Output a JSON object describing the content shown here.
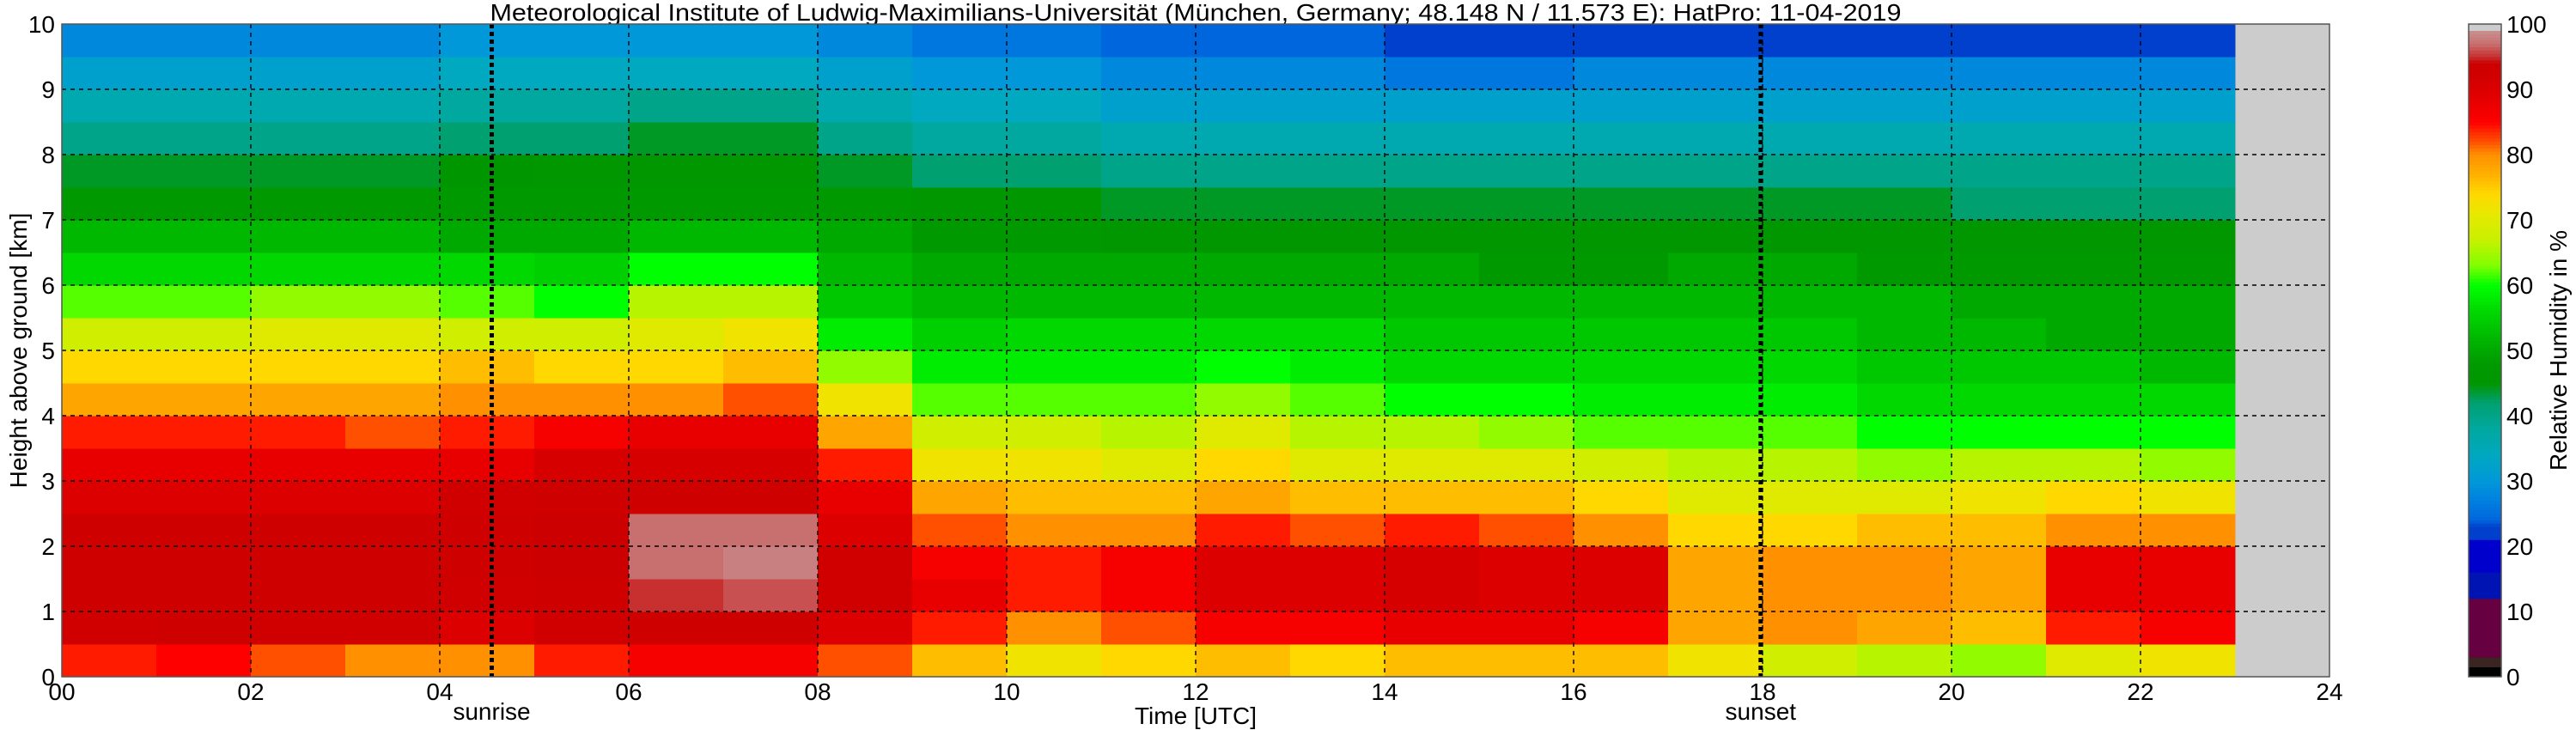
{
  "chart_data": {
    "type": "heatmap",
    "title": "Meteorological Institute of Ludwig-Maximilians-Universität (München, Germany; 48.148 N / 11.573 E):    HatPro: 11-04-2019",
    "xlabel": "Time [UTC]",
    "ylabel": "Height above ground [km]",
    "colorbar_label": "Relative Humidity in %",
    "xlim": [
      0,
      24
    ],
    "ylim": [
      0,
      10
    ],
    "clim": [
      0,
      100
    ],
    "grid": true,
    "x_ticks": [
      "00",
      "02",
      "04",
      "06",
      "08",
      "10",
      "12",
      "14",
      "16",
      "18",
      "20",
      "22",
      "24"
    ],
    "x_tick_values": [
      0,
      2,
      4,
      6,
      8,
      10,
      12,
      14,
      16,
      18,
      20,
      22,
      24
    ],
    "y_ticks": [
      "0",
      "1",
      "2",
      "3",
      "4",
      "5",
      "6",
      "7",
      "8",
      "9",
      "10"
    ],
    "colorbar_ticks": [
      "0",
      "10",
      "20",
      "30",
      "40",
      "50",
      "60",
      "70",
      "80",
      "90",
      "100"
    ],
    "annotations": [
      {
        "label": "sunrise",
        "time": 4.55
      },
      {
        "label": "sunset",
        "time": 17.98
      }
    ],
    "no_data_color": "#cccccc",
    "time_bin_hours": 1,
    "height_bin_km": 0.5,
    "time_start": [
      0,
      1,
      2,
      3,
      4,
      5,
      6,
      7,
      8,
      9,
      10,
      11,
      12,
      13,
      14,
      15,
      16,
      17,
      18,
      19,
      20,
      21,
      22
    ],
    "height_start_km": [
      0,
      0.5,
      1,
      1.5,
      2,
      2.5,
      3,
      3.5,
      4,
      4.5,
      5,
      5.5,
      6,
      6.5,
      7,
      7.5,
      8,
      8.5,
      9,
      9.5
    ],
    "values": [
      [
        84,
        92,
        93,
        93,
        93,
        90,
        88,
        84,
        78,
        74,
        68,
        62,
        56,
        52,
        47,
        44,
        40,
        36,
        32,
        28
      ],
      [
        85,
        93,
        93,
        93,
        93,
        90,
        88,
        84,
        78,
        74,
        68,
        62,
        56,
        52,
        47,
        44,
        40,
        36,
        32,
        28
      ],
      [
        82,
        92,
        93,
        93,
        93,
        90,
        88,
        84,
        78,
        74,
        70,
        64,
        56,
        52,
        48,
        44,
        40,
        36,
        32,
        28
      ],
      [
        80,
        92,
        93,
        93,
        93,
        90,
        88,
        82,
        78,
        74,
        70,
        64,
        56,
        52,
        48,
        44,
        40,
        36,
        32,
        28
      ],
      [
        80,
        90,
        92,
        93,
        93,
        92,
        88,
        84,
        80,
        76,
        68,
        62,
        56,
        50,
        48,
        45,
        42,
        38,
        34,
        30
      ],
      [
        84,
        92,
        93,
        94,
        94,
        93,
        91,
        86,
        80,
        74,
        68,
        60,
        55,
        50,
        48,
        46,
        42,
        38,
        34,
        30
      ],
      [
        86,
        93,
        95,
        97,
        97,
        93,
        91,
        88,
        80,
        74,
        70,
        66,
        60,
        52,
        48,
        46,
        44,
        40,
        34,
        30
      ],
      [
        86,
        93,
        96,
        98,
        97,
        93,
        91,
        88,
        82,
        76,
        72,
        66,
        60,
        52,
        48,
        46,
        44,
        40,
        34,
        30
      ],
      [
        82,
        90,
        92,
        92,
        90,
        88,
        84,
        78,
        72,
        64,
        58,
        54,
        52,
        50,
        48,
        44,
        40,
        36,
        32,
        28
      ],
      [
        76,
        84,
        88,
        86,
        82,
        78,
        72,
        68,
        62,
        58,
        55,
        52,
        50,
        48,
        46,
        42,
        38,
        34,
        30,
        26
      ],
      [
        72,
        80,
        84,
        84,
        80,
        76,
        72,
        68,
        62,
        58,
        56,
        52,
        50,
        48,
        46,
        42,
        38,
        34,
        30,
        26
      ],
      [
        74,
        82,
        86,
        86,
        80,
        76,
        70,
        66,
        62,
        58,
        56,
        52,
        50,
        46,
        44,
        40,
        36,
        32,
        28,
        24
      ],
      [
        76,
        86,
        90,
        90,
        84,
        78,
        74,
        70,
        64,
        60,
        56,
        52,
        50,
        46,
        44,
        40,
        36,
        32,
        28,
        24
      ],
      [
        74,
        86,
        90,
        90,
        82,
        76,
        70,
        66,
        62,
        58,
        56,
        52,
        50,
        46,
        44,
        40,
        36,
        32,
        28,
        24
      ],
      [
        76,
        88,
        91,
        91,
        84,
        76,
        70,
        66,
        60,
        56,
        54,
        52,
        50,
        46,
        44,
        40,
        36,
        32,
        26,
        22
      ],
      [
        76,
        88,
        90,
        90,
        82,
        76,
        70,
        64,
        60,
        56,
        54,
        52,
        48,
        46,
        44,
        40,
        36,
        32,
        26,
        22
      ],
      [
        76,
        86,
        90,
        90,
        80,
        74,
        68,
        62,
        58,
        56,
        54,
        52,
        48,
        46,
        44,
        40,
        36,
        32,
        28,
        22
      ],
      [
        72,
        78,
        78,
        78,
        74,
        70,
        66,
        62,
        58,
        56,
        54,
        52,
        50,
        46,
        44,
        40,
        36,
        32,
        28,
        22
      ],
      [
        68,
        80,
        80,
        80,
        74,
        70,
        66,
        62,
        58,
        56,
        54,
        52,
        50,
        46,
        44,
        40,
        36,
        32,
        28,
        22
      ],
      [
        66,
        78,
        80,
        80,
        76,
        70,
        64,
        60,
        56,
        54,
        52,
        52,
        48,
        46,
        44,
        40,
        36,
        32,
        28,
        22
      ],
      [
        64,
        76,
        78,
        78,
        76,
        72,
        66,
        60,
        56,
        54,
        52,
        50,
        48,
        46,
        42,
        40,
        36,
        32,
        28,
        22
      ],
      [
        70,
        84,
        88,
        88,
        80,
        74,
        66,
        60,
        56,
        54,
        50,
        50,
        48,
        46,
        42,
        40,
        36,
        32,
        28,
        22
      ],
      [
        72,
        86,
        88,
        88,
        80,
        72,
        64,
        60,
        56,
        52,
        50,
        50,
        48,
        46,
        42,
        40,
        36,
        32,
        28,
        22
      ]
    ],
    "colormap": [
      [
        0,
        "#000000"
      ],
      [
        1.5,
        "#000000"
      ],
      [
        1.6,
        "#3a2520"
      ],
      [
        3,
        "#3a2520"
      ],
      [
        3.1,
        "#660040"
      ],
      [
        12,
        "#660040"
      ],
      [
        12.1,
        "#0014b4"
      ],
      [
        16,
        "#0014b4"
      ],
      [
        16.1,
        "#0000cc"
      ],
      [
        21,
        "#0000cc"
      ],
      [
        21.1,
        "#0040cc"
      ],
      [
        23,
        "#0040cc"
      ],
      [
        24,
        "#0066dd"
      ],
      [
        27,
        "#0080e0"
      ],
      [
        30,
        "#0098d8"
      ],
      [
        34,
        "#00a8c0"
      ],
      [
        38,
        "#00a8a0"
      ],
      [
        42,
        "#00a070"
      ],
      [
        45,
        "#009600"
      ],
      [
        48,
        "#009a00"
      ],
      [
        52,
        "#00b800"
      ],
      [
        56,
        "#00d800"
      ],
      [
        60,
        "#00ff00"
      ],
      [
        63,
        "#80ff00"
      ],
      [
        67,
        "#c8f000"
      ],
      [
        71,
        "#e8e800"
      ],
      [
        74,
        "#ffd800"
      ],
      [
        77,
        "#ffb000"
      ],
      [
        80,
        "#ff9000"
      ],
      [
        82,
        "#ff5000"
      ],
      [
        85,
        "#ff0000"
      ],
      [
        88,
        "#e80000"
      ],
      [
        92,
        "#d00000"
      ],
      [
        94,
        "#cc0000"
      ],
      [
        95,
        "#c83030"
      ],
      [
        97,
        "#c87070"
      ],
      [
        99,
        "#c89090"
      ],
      [
        99.1,
        "#cccccc"
      ],
      [
        100,
        "#cccccc"
      ]
    ]
  }
}
